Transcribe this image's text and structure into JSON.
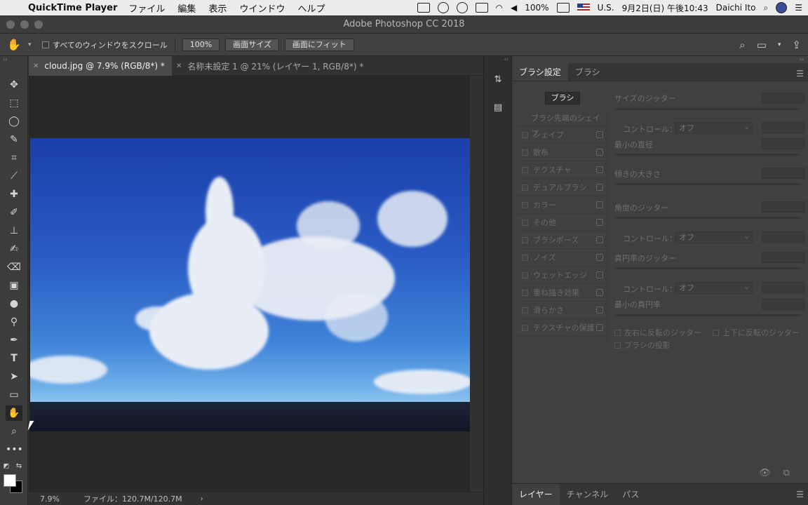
{
  "menubar": {
    "app_name": "QuickTime Player",
    "items": [
      "ファイル",
      "編集",
      "表示",
      "ウインドウ",
      "ヘルプ"
    ],
    "battery": "100%",
    "input_source": "U.S.",
    "clock": "9月2日(日) 午後10:43",
    "user": "Daichi Ito"
  },
  "window": {
    "title": "Adobe Photoshop CC 2018"
  },
  "options": {
    "scroll_all_label": "すべてのウィンドウをスクロール",
    "zoom_100_label": "100%",
    "screen_size_label": "画面サイズ",
    "fit_screen_label": "画面にフィット"
  },
  "tabs": [
    {
      "label": "cloud.jpg @ 7.9% (RGB/8*) *",
      "active": true
    },
    {
      "label": "名称未設定 1 @ 21% (レイヤー 1, RGB/8*) *",
      "active": false
    }
  ],
  "status": {
    "zoom": "7.9%",
    "file": "ファイル：120.7M/120.7M"
  },
  "panel": {
    "tabs": [
      "ブラシ設定",
      "ブラシ"
    ],
    "brush_button": "ブラシ",
    "brush_tip_heading": "ブラシ先端のシェイプ",
    "options": [
      "シェイプ",
      "散布",
      "テクスチャ",
      "デュアルブラシ",
      "カラー",
      "その他",
      "ブラシポーズ",
      "ノイズ",
      "ウェットエッジ",
      "重ね描き効果",
      "滑らかさ",
      "テクスチャの保護"
    ],
    "size_jitter": "サイズのジッター",
    "control_label": "コントロール：",
    "control_value": "オフ",
    "min_diameter": "最小の直径",
    "tilt_scale": "傾きの大きさ",
    "angle_jitter": "角度のジッター",
    "roundness_jitter": "真円率のジッター",
    "min_roundness": "最小の真円率",
    "flip_x": "左右に反転のジッター",
    "flip_y": "上下に反転のジッター",
    "brush_projection": "ブラシの投影"
  },
  "layers_tabs": [
    "レイヤー",
    "チャンネル",
    "パス"
  ],
  "colors": {
    "foreground": "#ffffff",
    "background": "#000000"
  }
}
